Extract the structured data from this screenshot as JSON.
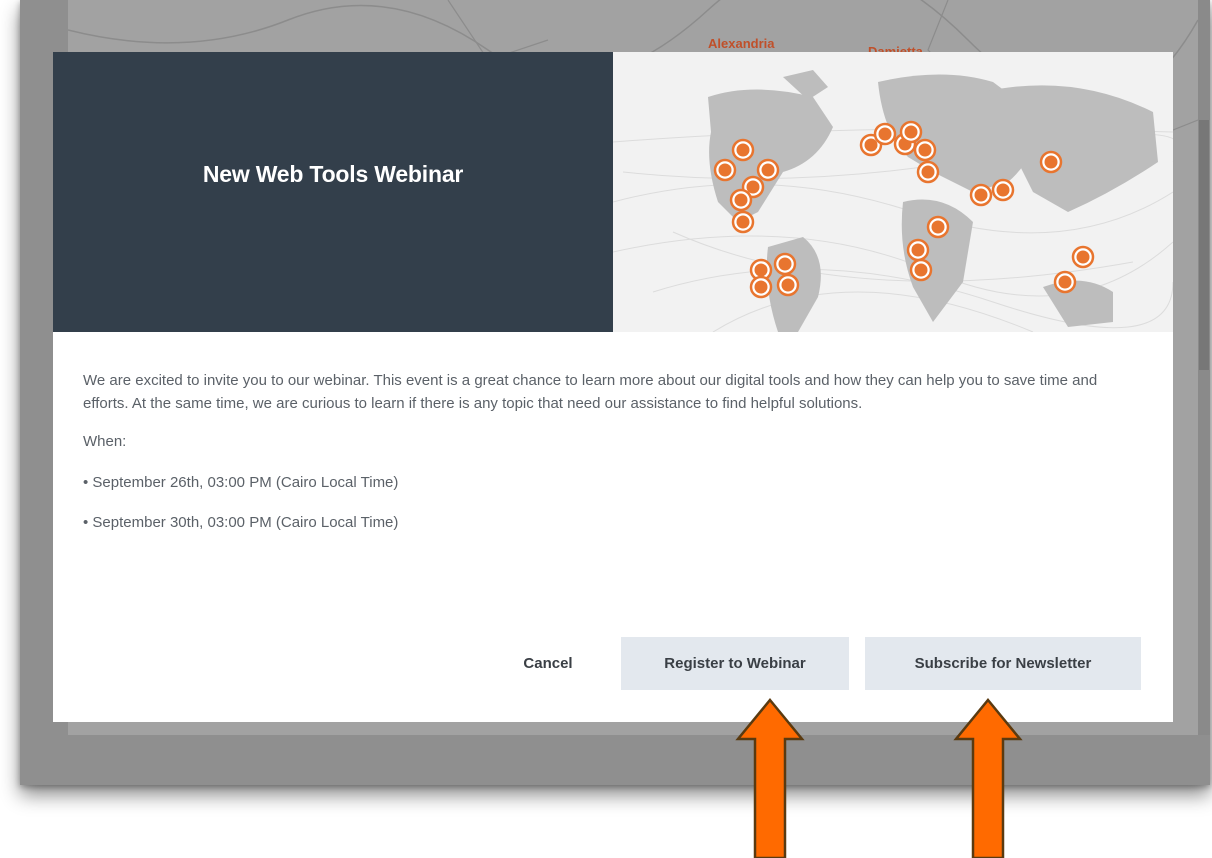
{
  "background": {
    "cities": [
      "Alexandria",
      "Damietta"
    ]
  },
  "modal": {
    "title": "New Web Tools Webinar",
    "intro": "We are excited to invite you to our webinar. This event is a great chance to learn more about our digital tools and how they can help you to save time and efforts. At the same time, we are curious to learn if there is any topic that need our assistance to find helpful solutions.",
    "when_label": "When:",
    "dates": [
      "• September 26th, 03:00 PM (Cairo Local Time)",
      "• September 30th, 03:00 PM (Cairo Local Time)"
    ],
    "buttons": {
      "cancel": "Cancel",
      "register": "Register to Webinar",
      "subscribe": "Subscribe for Newsletter"
    }
  },
  "colors": {
    "header_dark": "#333f4b",
    "button_bg": "#e3e8ee",
    "marker_orange": "#e8752f",
    "arrow_orange": "#ff6a00",
    "arrow_outline": "#5a3a10"
  },
  "icons": [
    "map-marker-icon",
    "arrow-up-icon"
  ]
}
